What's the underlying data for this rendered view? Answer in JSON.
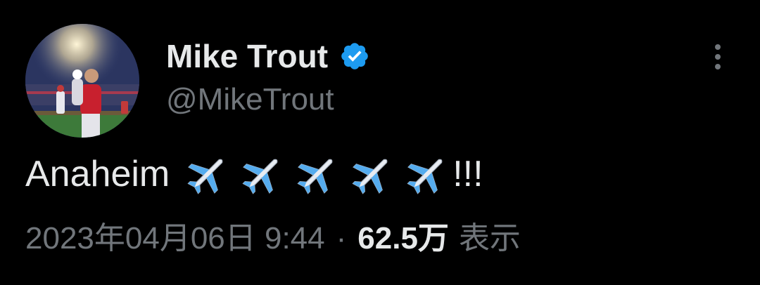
{
  "tweet": {
    "author": {
      "display_name": "Mike Trout",
      "handle": "@MikeTrout",
      "verified": true,
      "verified_color": "#1d9bf0"
    },
    "text": {
      "word": "Anaheim",
      "emoji": [
        "airplane-emoji",
        "airplane-emoji",
        "airplane-emoji",
        "airplane-emoji",
        "airplane-emoji"
      ],
      "suffix": "!!!"
    },
    "meta": {
      "date": "2023年04月06日 9:44",
      "separator": "·",
      "views": "62.5万",
      "views_label": "表示"
    },
    "icons": {
      "more": "more-vertical-icon",
      "verified": "verified-badge-icon"
    }
  },
  "colors": {
    "background": "#000000",
    "primary_text": "#e7e9ea",
    "secondary_text": "#71767b",
    "accent": "#1d9bf0"
  }
}
